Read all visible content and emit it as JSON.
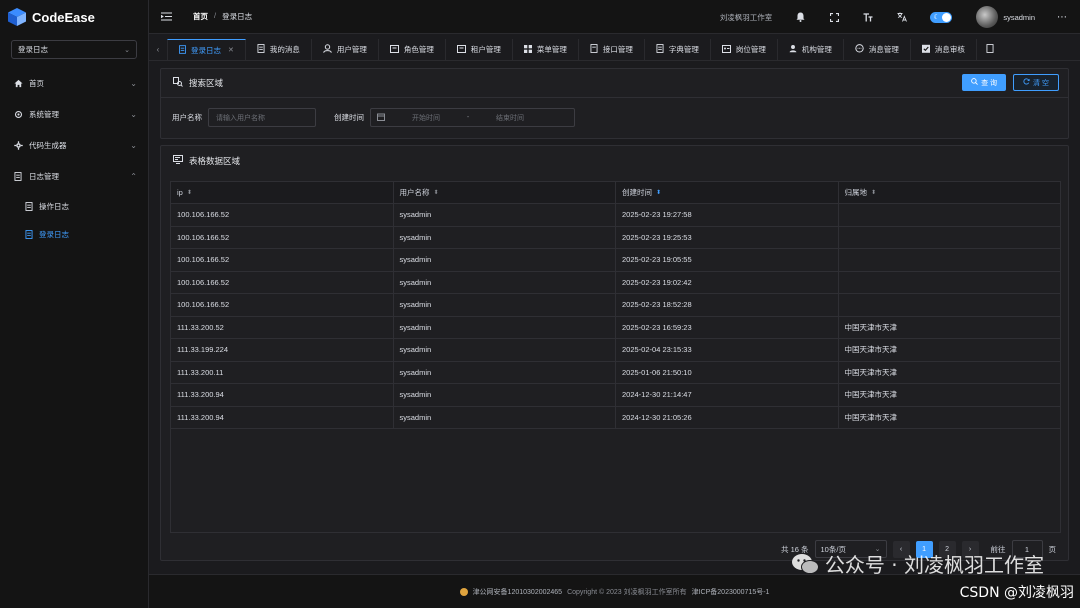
{
  "app": {
    "name": "CodeEase"
  },
  "sidebar": {
    "select_value": "登录日志",
    "items": [
      {
        "label": "首页",
        "icon": "home-icon"
      },
      {
        "label": "系统管理",
        "icon": "gear-icon"
      },
      {
        "label": "代码生成器",
        "icon": "settings-icon"
      },
      {
        "label": "日志管理",
        "icon": "document-icon"
      }
    ],
    "sub_items": [
      {
        "label": "操作日志",
        "icon": "document-icon"
      },
      {
        "label": "登录日志",
        "icon": "document-icon"
      }
    ]
  },
  "header": {
    "breadcrumb_home": "首页",
    "breadcrumb_sep": "/",
    "breadcrumb_current": "登录日志",
    "studio": "刘凌枫羽工作室",
    "username": "sysadmin"
  },
  "tabs": [
    {
      "label": "登录日志",
      "icon": "document-icon"
    },
    {
      "label": "我的消息",
      "icon": "message-icon"
    },
    {
      "label": "用户管理",
      "icon": "user-icon"
    },
    {
      "label": "角色管理",
      "icon": "role-icon"
    },
    {
      "label": "租户管理",
      "icon": "tenant-icon"
    },
    {
      "label": "菜单管理",
      "icon": "grid-icon"
    },
    {
      "label": "接口管理",
      "icon": "api-icon"
    },
    {
      "label": "字典管理",
      "icon": "book-icon"
    },
    {
      "label": "岗位管理",
      "icon": "id-card-icon"
    },
    {
      "label": "机构管理",
      "icon": "org-icon"
    },
    {
      "label": "消息管理",
      "icon": "chat-icon"
    },
    {
      "label": "消息审核",
      "icon": "check-icon"
    }
  ],
  "search": {
    "title": "搜索区域",
    "query_label": "查 询",
    "clear_label": "清 空",
    "username_label": "用户名称",
    "username_placeholder": "请输入用户名称",
    "time_label": "创建时间",
    "start_placeholder": "开始时间",
    "range_sep": "-",
    "end_placeholder": "结束时间"
  },
  "table": {
    "title": "表格数据区域",
    "columns": [
      "ip",
      "用户名称",
      "创建时间",
      "归属地"
    ],
    "rows": [
      [
        "100.106.166.52",
        "sysadmin",
        "2025-02-23 19:27:58",
        ""
      ],
      [
        "100.106.166.52",
        "sysadmin",
        "2025-02-23 19:25:53",
        ""
      ],
      [
        "100.106.166.52",
        "sysadmin",
        "2025-02-23 19:05:55",
        ""
      ],
      [
        "100.106.166.52",
        "sysadmin",
        "2025-02-23 19:02:42",
        ""
      ],
      [
        "100.106.166.52",
        "sysadmin",
        "2025-02-23 18:52:28",
        ""
      ],
      [
        "111.33.200.52",
        "sysadmin",
        "2025-02-23 16:59:23",
        "中国天津市天津"
      ],
      [
        "111.33.199.224",
        "sysadmin",
        "2025-02-04 23:15:33",
        "中国天津市天津"
      ],
      [
        "111.33.200.11",
        "sysadmin",
        "2025-01-06 21:50:10",
        "中国天津市天津"
      ],
      [
        "111.33.200.94",
        "sysadmin",
        "2024-12-30 21:14:47",
        "中国天津市天津"
      ],
      [
        "111.33.200.94",
        "sysadmin",
        "2024-12-30 21:05:26",
        "中国天津市天津"
      ]
    ]
  },
  "pagination": {
    "total": "共 16 条",
    "page_size": "10条/页",
    "prev": "‹",
    "pages": [
      "1",
      "2"
    ],
    "next": "›",
    "goto_label": "前往",
    "goto_value": "1",
    "page_unit": "页"
  },
  "footer": {
    "beian": "津公网安备12010302002465",
    "copyright": "Copyright © 2023 刘凌枫羽工作室所有",
    "icp": "津ICP备2023000715号-1"
  },
  "watermark": {
    "text": "公众号 · 刘凌枫羽工作室",
    "csdn": "CSDN @刘凌枫羽"
  },
  "colors": {
    "accent": "#409eff",
    "background": "#1b1b1e",
    "panel": "#1f1f22"
  }
}
